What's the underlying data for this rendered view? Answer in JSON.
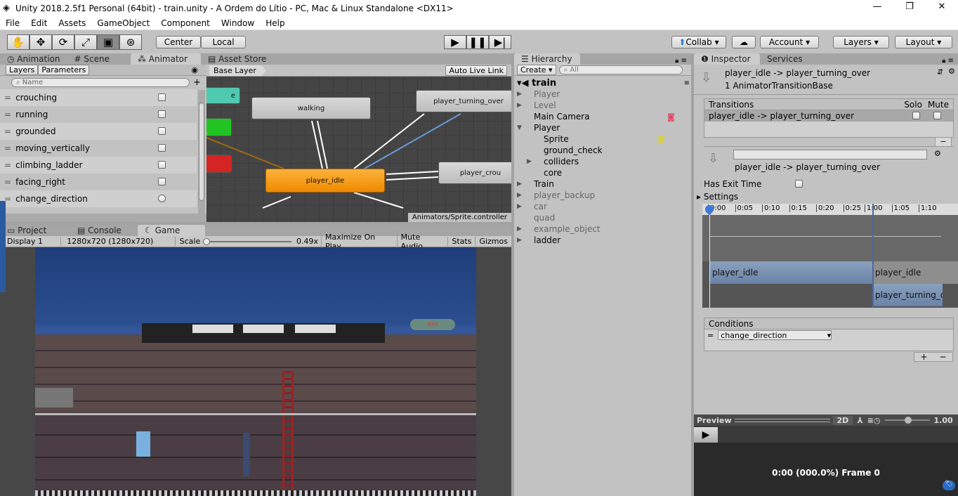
{
  "window": {
    "title": "Unity 2018.2.5f1 Personal (64bit) - train.unity - A Ordem do Lítio - PC, Mac & Linux Standalone <DX11>",
    "minimize": "—",
    "maximize": "❐",
    "close": "✕"
  },
  "menu": [
    "File",
    "Edit",
    "Assets",
    "GameObject",
    "Component",
    "Window",
    "Help"
  ],
  "toolbar": {
    "tools": [
      "hand-tool",
      "move-tool",
      "rotate-tool",
      "scale-tool",
      "rect-tool",
      "transform-tool"
    ],
    "center": "Center",
    "local": "Local",
    "collab": "Collab ▾",
    "account": "Account ▾",
    "layers": "Layers ▾",
    "layout": "Layout ▾"
  },
  "left_tabs": [
    "Animation",
    "Scene",
    "Animator",
    "Asset Store"
  ],
  "animator": {
    "subtabs": [
      "Layers",
      "Parameters"
    ],
    "search_placeholder": "Name",
    "breadcrumb": "Base Layer",
    "auto_live_link": "Auto Live Link",
    "footer": "Animators/Sprite.controller",
    "parameters": [
      {
        "name": "crouching",
        "type": "bool"
      },
      {
        "name": "running",
        "type": "bool"
      },
      {
        "name": "grounded",
        "type": "bool"
      },
      {
        "name": "moving_vertically",
        "type": "bool"
      },
      {
        "name": "climbing_ladder",
        "type": "bool"
      },
      {
        "name": "facing_right",
        "type": "bool"
      },
      {
        "name": "change_direction",
        "type": "trigger"
      }
    ],
    "states": {
      "walking": "walking",
      "turning": "player_turning_over",
      "idle": "player_idle",
      "crouch": "player_crou",
      "entry": "e"
    }
  },
  "bottom_tabs": [
    "Project",
    "Console",
    "Game"
  ],
  "game_toolbar": {
    "display": "Display 1",
    "resolution": "1280x720 (1280x720)",
    "scale_label": "Scale",
    "scale_value": "0.49x",
    "maximize": "Maximize On Play",
    "mute": "Mute Audio",
    "stats": "Stats",
    "gizmos": "Gizmos"
  },
  "game": {
    "gas_label": "GAS"
  },
  "hierarchy": {
    "tab": "Hierarchy",
    "create": "Create",
    "search_placeholder": "All",
    "scene": "train",
    "items": [
      {
        "name": "Player",
        "depth": 1,
        "arrow": true,
        "dim": true
      },
      {
        "name": "Level",
        "depth": 1,
        "arrow": true,
        "dim": true
      },
      {
        "name": "Main Camera",
        "depth": 1,
        "arrow": false
      },
      {
        "name": "Player",
        "depth": 1,
        "arrow": true,
        "open": true
      },
      {
        "name": "Sprite",
        "depth": 2,
        "arrow": false
      },
      {
        "name": "ground_check",
        "depth": 2,
        "arrow": false
      },
      {
        "name": "colliders",
        "depth": 2,
        "arrow": true
      },
      {
        "name": "core",
        "depth": 2,
        "arrow": false
      },
      {
        "name": "Train",
        "depth": 1,
        "arrow": true
      },
      {
        "name": "player_backup",
        "depth": 1,
        "arrow": true,
        "dim": true
      },
      {
        "name": "car",
        "depth": 1,
        "arrow": true,
        "dim": true
      },
      {
        "name": "quad",
        "depth": 1,
        "arrow": false,
        "dim": true
      },
      {
        "name": "example_object",
        "depth": 1,
        "arrow": true,
        "dim": true
      },
      {
        "name": "ladder",
        "depth": 1,
        "arrow": true
      }
    ]
  },
  "inspector": {
    "tabs": [
      "Inspector",
      "Services"
    ],
    "title": "player_idle -> player_turning_over",
    "subtitle": "1 AnimatorTransitionBase",
    "transitions_header": "Transitions",
    "solo": "Solo",
    "mute": "Mute",
    "transition_row": "player_idle -> player_turning_over",
    "transition_name": "player_idle -> player_turning_over",
    "has_exit_time": "Has Exit Time",
    "has_exit_time_checked": false,
    "settings": "Settings",
    "timeline_ticks": [
      "0:00",
      "0:05",
      "0:10",
      "0:15",
      "0:20",
      "0:25",
      "1:00",
      "1:05",
      "1:10"
    ],
    "timeline_clips": {
      "source": "player_idle",
      "source2": "player_idle",
      "dest": "player_turning_o"
    },
    "conditions_header": "Conditions",
    "condition": "change_direction",
    "preview": {
      "label": "Preview",
      "mode": "2D",
      "speed": "1.00",
      "status": "0:00 (000.0%) Frame 0"
    }
  },
  "colors": {
    "idle_state": "#f59a12",
    "entry_state": "#4fc9b0",
    "any_state": "#22c422",
    "exit_state": "#d42424",
    "selected_transition": "#6a9ad8",
    "clip": "#7a8fae"
  }
}
